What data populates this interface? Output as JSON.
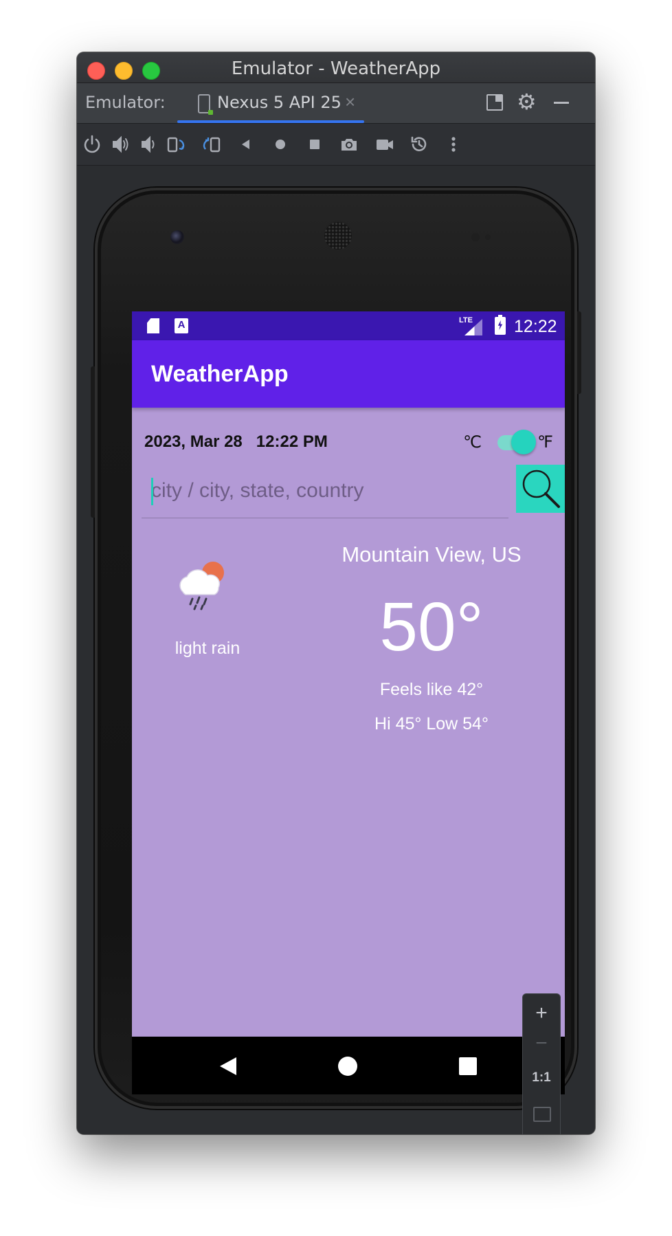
{
  "window": {
    "title": "Emulator - WeatherApp"
  },
  "tabbar": {
    "label": "Emulator:",
    "device_tab": "Nexus 5 API 25",
    "close_glyph": "×"
  },
  "toolbar": {
    "icons": [
      "power-icon",
      "volume-up-icon",
      "volume-down-icon",
      "rotate-left-icon",
      "rotate-right-icon",
      "back-icon",
      "home-icon",
      "overview-icon",
      "screenshot-icon",
      "screen-record-icon",
      "snapshot-icon",
      "more-icon"
    ]
  },
  "statusbar": {
    "time": "12:22",
    "a_badge": "A",
    "lte_label": "LTE"
  },
  "app": {
    "title": "WeatherApp",
    "date": "2023, Mar 28",
    "time": "12:22 PM",
    "unit_celsius": "℃",
    "unit_fahrenheit": "℉",
    "unit_toggle_on": true,
    "search_placeholder": "city / city, state, country",
    "search_value": "",
    "condition": "light rain",
    "city": "Mountain View, US",
    "temperature": "50°",
    "feels_like": "Feels like 42°",
    "hi_low": "Hi 45° Low 54°"
  },
  "zoom_controls": {
    "zoom_in": "+",
    "zoom_out": "−",
    "actual_size": "1:1"
  },
  "colors": {
    "status_bar": "#3a17b0",
    "app_bar": "#6021e8",
    "background": "#b39ad6",
    "accent": "#2ad6bf",
    "tab_underline": "#3574f0"
  }
}
